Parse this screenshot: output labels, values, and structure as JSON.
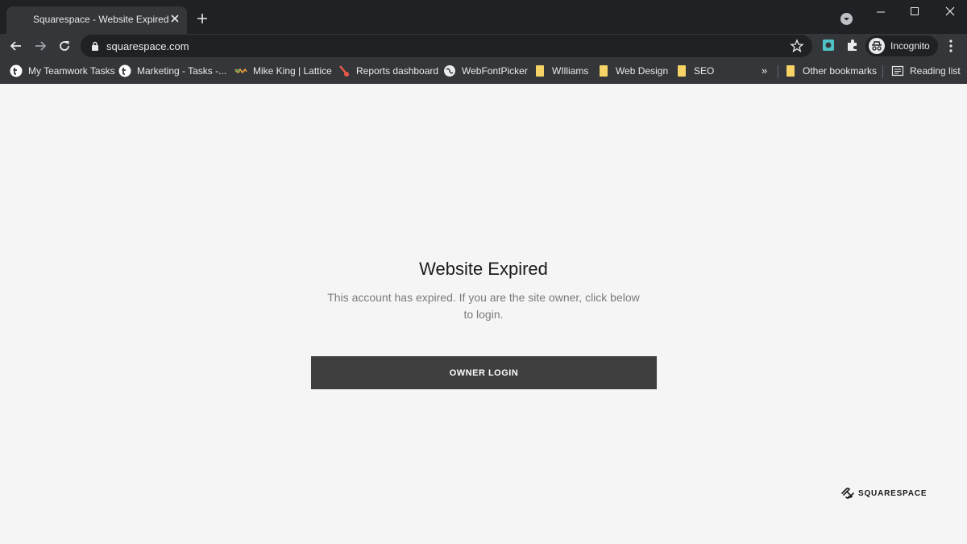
{
  "browser": {
    "tab": {
      "title": "Squarespace - Website Expired"
    },
    "address_bar": {
      "url": "squarespace.com"
    },
    "profile": {
      "label": "Incognito"
    },
    "bookmarks": [
      {
        "label": "My Teamwork Tasks",
        "icon": "teamwork-icon"
      },
      {
        "label": "Marketing - Tasks -...",
        "icon": "teamwork-icon"
      },
      {
        "label": "Mike King | Lattice",
        "icon": "lattice-icon"
      },
      {
        "label": "Reports dashboard",
        "icon": "reports-icon"
      },
      {
        "label": "WebFontPicker",
        "icon": "globe-icon"
      },
      {
        "label": "WIlliams",
        "icon": "folder-icon"
      },
      {
        "label": "Web Design",
        "icon": "folder-icon"
      },
      {
        "label": "SEO",
        "icon": "folder-icon"
      }
    ],
    "bookmarks_overflow": "»",
    "other_bookmarks": "Other bookmarks",
    "reading_list": "Reading list"
  },
  "page": {
    "heading": "Website Expired",
    "message": "This account has expired. If you are the site owner, click below to login.",
    "button_label": "OWNER LOGIN",
    "brand": "SQUARESPACE"
  },
  "colors": {
    "page_background": "#f5f5f5",
    "button_background": "#3f3f3f",
    "browser_frame": "#202124",
    "browser_toolbar": "#35363a"
  }
}
